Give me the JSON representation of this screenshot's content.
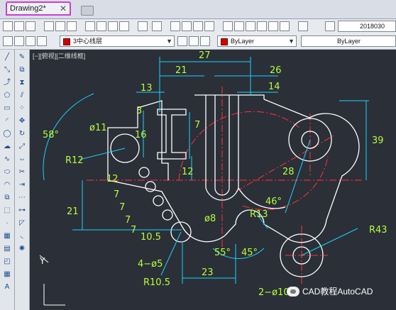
{
  "tabs": {
    "doc_tab_label": "Drawing2*",
    "close_glyph": "✕"
  },
  "toolbar1": {
    "date_text": "2018030"
  },
  "toolbar2": {
    "layer_value": "3中心线层",
    "color_value": "ByLayer",
    "linetype_value": "ByLayer"
  },
  "viewport": {
    "label": "[−][俯视][二维线框]"
  },
  "dimensions": {
    "d27": "27",
    "d21": "21",
    "d26": "26",
    "d13": "13",
    "d14": "14",
    "d3": "3",
    "d16": "16",
    "d7": "7",
    "d39": "39",
    "d12v": "12",
    "d21v": "21",
    "dia11": "ø11",
    "r12": "R12",
    "a58": "58°",
    "r28": "28",
    "a46": "46°",
    "r13": "R13",
    "r43": "R43",
    "dia8": "ø8",
    "a55": "55°",
    "a45": "45°",
    "d23": "23",
    "r105": "R10.5",
    "n4dia5": "4−ø5",
    "n2dia10": "2−ø10",
    "d105": "10.5",
    "s12": "12",
    "s7": [
      "7",
      "7",
      "7",
      "7"
    ]
  },
  "watermark": {
    "text": "CAD教程AutoCAD"
  },
  "colors": {
    "dimension": "#15d6ff",
    "geometry": "#ffffff",
    "centerline": "#ff3333",
    "text_dim": "#b6ff3a"
  }
}
